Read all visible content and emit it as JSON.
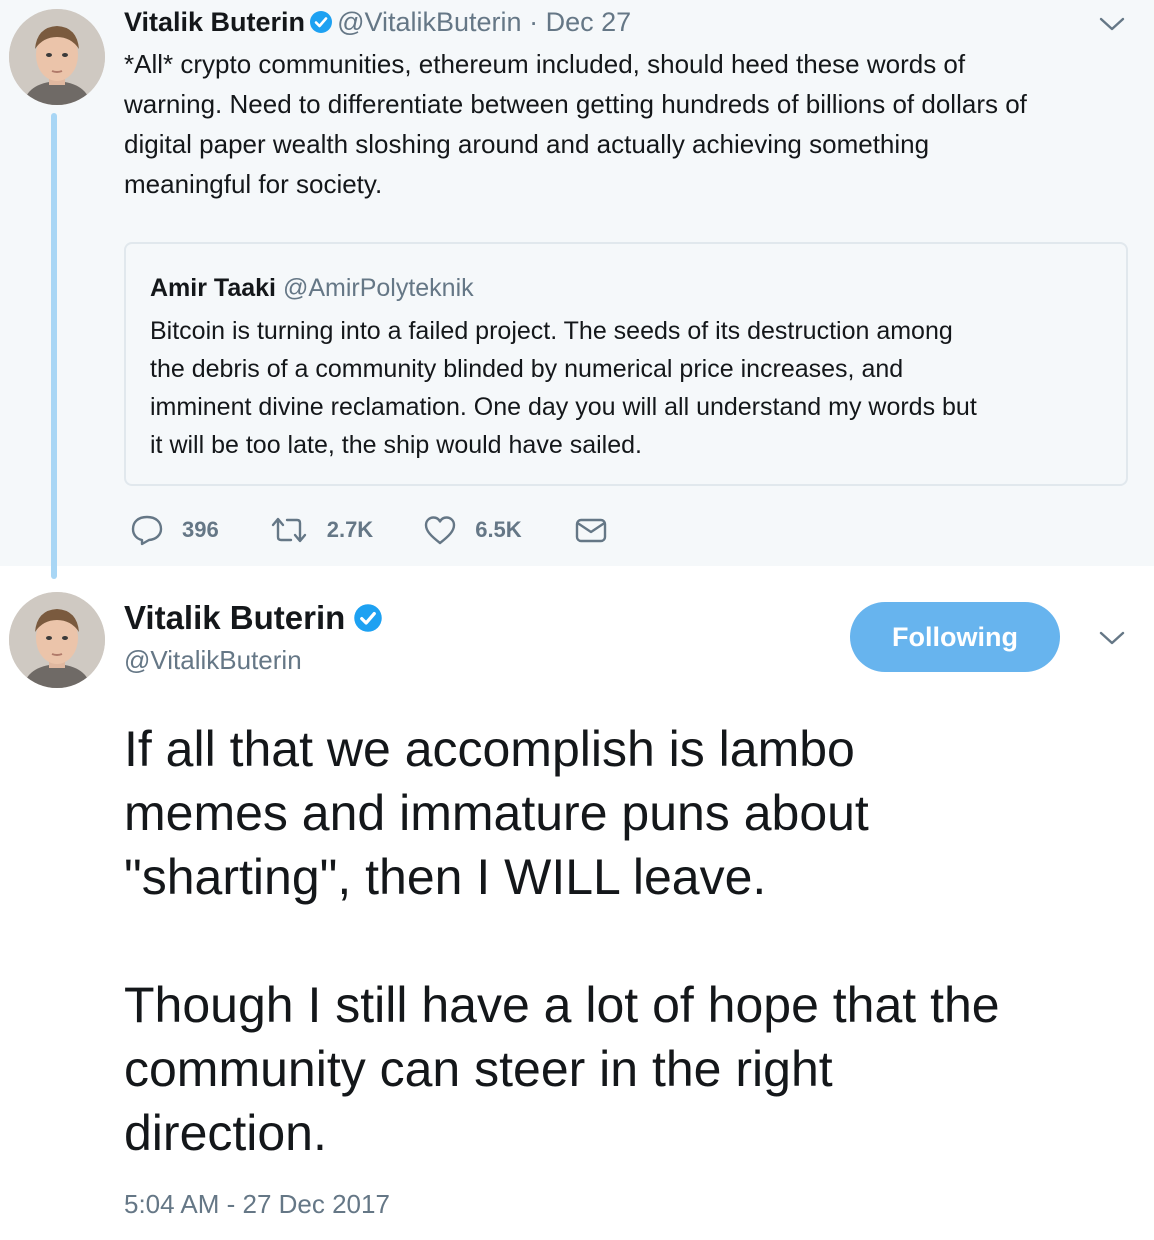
{
  "parent_tweet": {
    "author_name": "Vitalik Buterin",
    "handle": "@VitalikButerin",
    "separator": "·",
    "date": "Dec 27",
    "text": "*All* crypto communities, ethereum included, should heed these words of\nwarning. Need to differentiate between getting hundreds of billions of dollars of\ndigital paper wealth sloshing around and actually achieving something\nmeaningful for society.",
    "quoted_tweet": {
      "author_name": "Amir Taaki",
      "handle": "@AmirPolyteknik",
      "text": "Bitcoin is turning into a failed project. The seeds of its destruction among\nthe debris of a community blinded by numerical price increases, and\nimminent divine reclamation. One day you will all understand my words but\nit will be too late, the ship would have sailed."
    },
    "actions": {
      "replies": "396",
      "retweets": "2.7K",
      "likes": "6.5K"
    }
  },
  "main_tweet": {
    "author_name": "Vitalik Buterin",
    "handle": "@VitalikButerin",
    "follow_button_label": "Following",
    "text": "If all that we accomplish is lambo\nmemes and immature puns about\n\"sharting\", then I WILL leave.\n\nThough I still have a lot of hope that the\ncommunity can steer in the right\ndirection.",
    "timestamp": "5:04 AM - 27 Dec 2017"
  },
  "colors": {
    "accent": "#1da1f2",
    "follow_button": "#67b4ee",
    "thread_line": "#a8d6f5",
    "muted_text": "#657786",
    "parent_background": "#f5f8fa"
  },
  "icons": [
    "verified-badge-icon",
    "chevron-down-icon",
    "reply-icon",
    "retweet-icon",
    "like-icon",
    "direct-message-icon"
  ]
}
